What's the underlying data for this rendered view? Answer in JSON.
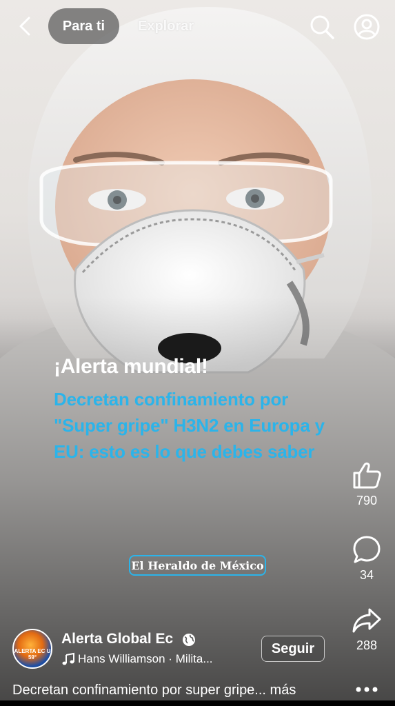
{
  "top_bar": {
    "tabs": [
      {
        "label": "Para ti",
        "active": true
      },
      {
        "label": "Explorar",
        "active": false
      }
    ],
    "icons": [
      "back-icon",
      "search-icon",
      "profile-icon"
    ]
  },
  "video": {
    "headline_alert": "¡Alerta mundial!",
    "headline_sub": "Decretan confinamiento por \"Super gripe\" H3N2 en Europa y EU: esto es lo que debes saber",
    "source_badge": "El Heraldo de México",
    "colors": {
      "accent_blue": "#2bb4ea",
      "white": "#ffffff"
    }
  },
  "actions": {
    "likes": "790",
    "comments": "34",
    "shares": "288"
  },
  "author": {
    "name": "Alerta Global Ec",
    "avatar_text": "ALERTA EC U 59°",
    "music": "Hans Williamson · Milita...",
    "follow_label": "Seguir"
  },
  "caption": {
    "text": "Decretan confinamiento por super gripe...",
    "more": "más"
  }
}
